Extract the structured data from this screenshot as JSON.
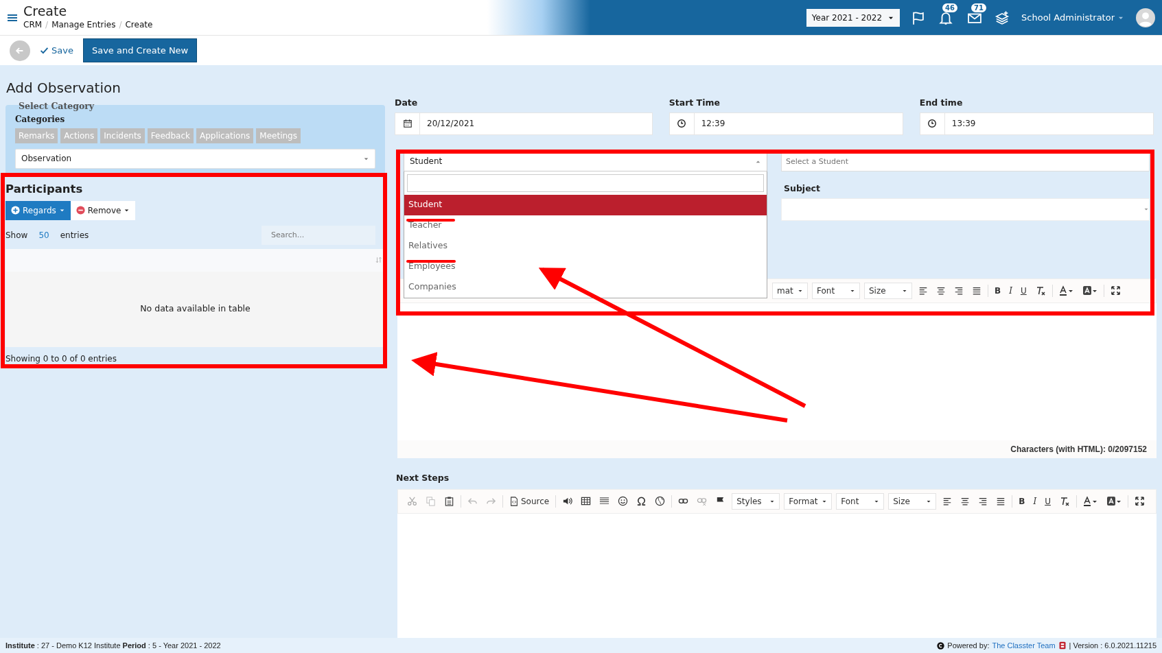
{
  "header": {
    "title": "Create",
    "breadcrumbs": [
      "CRM",
      "Manage Entries",
      "Create"
    ],
    "breadcrumb_separators": [
      "/",
      "/"
    ],
    "year_select": "Year 2021 - 2022",
    "notifications_count": "46",
    "messages_count": "71",
    "user": "School Administrator"
  },
  "actions": {
    "save": "Save",
    "save_new": "Save and Create New"
  },
  "page_title": "Add Observation",
  "category": {
    "legend": "Select Category",
    "label": "Categories",
    "tabs": [
      "Remarks",
      "Actions",
      "Incidents",
      "Feedback",
      "Applications",
      "Meetings"
    ],
    "select_value": "Observation"
  },
  "participants": {
    "title": "Participants",
    "regards_button": "Regards",
    "remove_button": "Remove",
    "show_label": "Show",
    "page_length": "50",
    "entries_label": "entries",
    "search_placeholder": "Search...",
    "empty_message": "No data available in table",
    "info": "Showing 0 to 0 of 0 entries"
  },
  "fields": [
    {
      "label": "Date",
      "value": "20/12/2021",
      "kind": "date"
    },
    {
      "label": "Start Time",
      "value": "12:39",
      "kind": "time"
    },
    {
      "label": "End time",
      "value": "13:39",
      "kind": "time"
    }
  ],
  "educator_dropdown": {
    "value": "Student",
    "expanded": true,
    "options": [
      {
        "label": "Student",
        "selected": true
      },
      {
        "label": "Teacher",
        "selected": false
      },
      {
        "label": "Relatives",
        "selected": false
      },
      {
        "label": "Employees",
        "selected": false
      },
      {
        "label": "Companies",
        "selected": false
      }
    ]
  },
  "student_select": {
    "placeholder": "Select a Student"
  },
  "subject": {
    "label": "Subject"
  },
  "description_editor": {
    "toolbar_selects": [
      "mat",
      "Font",
      "Size"
    ],
    "bold": "B",
    "italic": "I",
    "underline": "U",
    "character_count": "Characters (with HTML): 0/2097152"
  },
  "next_steps": {
    "label": "Next Steps",
    "source": "Source",
    "toolbar_selects": [
      "Styles",
      "Format",
      "Font",
      "Size"
    ],
    "bold": "B",
    "italic": "I",
    "underline": "U"
  },
  "footer": {
    "info": "**Institute** : 27 - Demo K12 Institute **Period** : 5 - Year 2021 - 2022",
    "powered_by": "Powered by:",
    "team_link": "The Classter Team",
    "version": "| Version : 6.0.2021.11215"
  }
}
